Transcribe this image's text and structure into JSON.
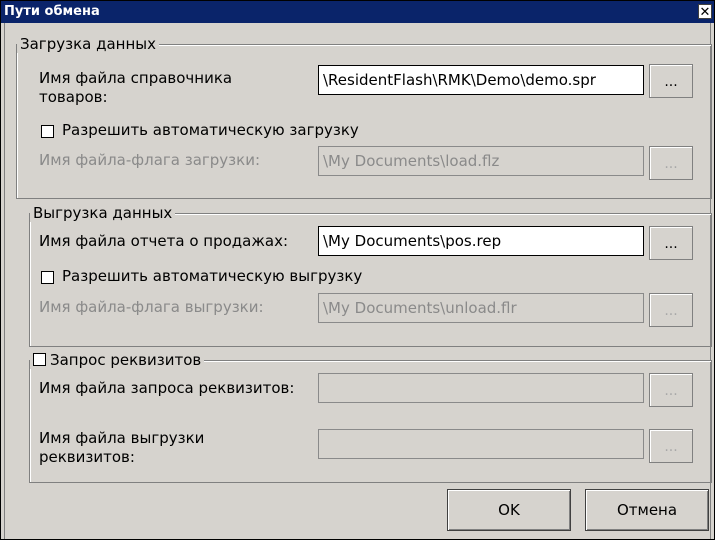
{
  "window": {
    "title": "Пути обмена",
    "close_icon": "✕"
  },
  "upload": {
    "legend": "Загрузка данных",
    "catalog_label": "Имя файла справочника товаров:",
    "catalog_value": "\\ResidentFlash\\RMK\\Demo\\demo.spr",
    "auto_label": "Разрешить автоматическую загрузку",
    "auto_checked": false,
    "flag_label": "Имя файла-флага загрузки:",
    "flag_value": "\\My Documents\\load.flz"
  },
  "download": {
    "legend": "Выгрузка данных",
    "report_label": "Имя файла отчета о продажах:",
    "report_value": "\\My Documents\\pos.rep",
    "auto_label": "Разрешить автоматическую выгрузку",
    "auto_checked": false,
    "flag_label": "Имя файла-флага выгрузки:",
    "flag_value": "\\My Documents\\unload.flr"
  },
  "requisites": {
    "legend": "Запрос реквизитов",
    "checked": false,
    "request_label": "Имя файла запроса реквизитов:",
    "request_value": "",
    "export_label": "Имя файла выгрузки реквизитов:",
    "export_value": ""
  },
  "browse_label": "...",
  "buttons": {
    "ok": "OK",
    "cancel": "Отмена"
  }
}
